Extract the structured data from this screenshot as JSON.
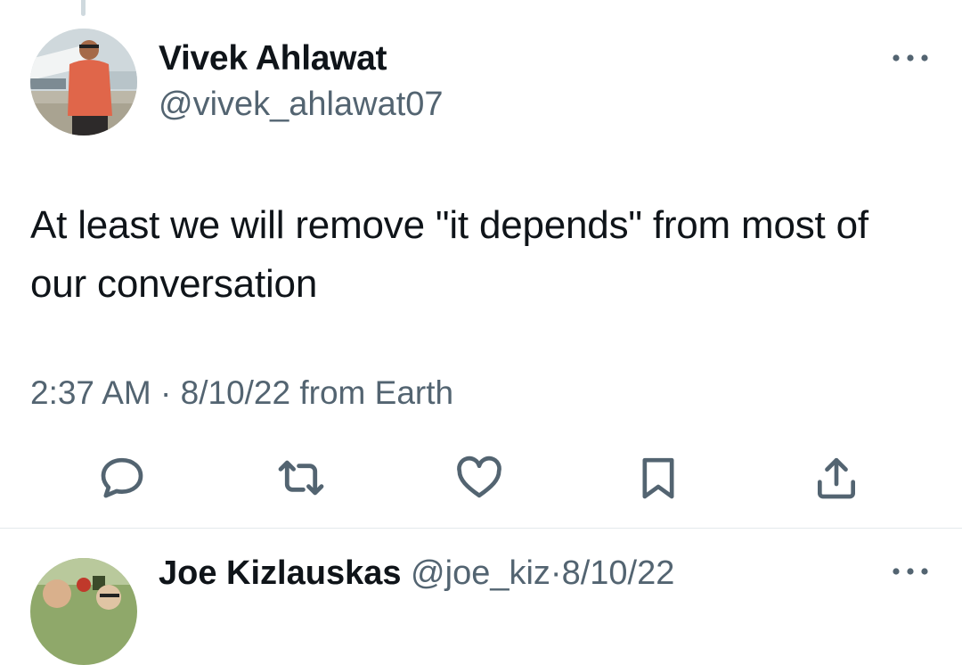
{
  "tweet": {
    "author": {
      "name": "Vivek Ahlawat",
      "handle": "@vivek_ahlawat07"
    },
    "text": "At least we will remove \"it depends\" from most of our conversation",
    "meta": "2:37 AM · 8/10/22 from Earth"
  },
  "reply": {
    "author": {
      "name": "Joe Kizlauskas",
      "handle": "@joe_kiz"
    },
    "separator": "·",
    "date": "8/10/22"
  },
  "icons": {
    "more": "more-icon",
    "reply": "reply-icon",
    "retweet": "retweet-icon",
    "like": "heart-icon",
    "bookmark": "bookmark-icon",
    "share": "share-icon"
  },
  "colors": {
    "text": "#0f1419",
    "secondary": "#536471",
    "divider": "#e4e9ec"
  }
}
